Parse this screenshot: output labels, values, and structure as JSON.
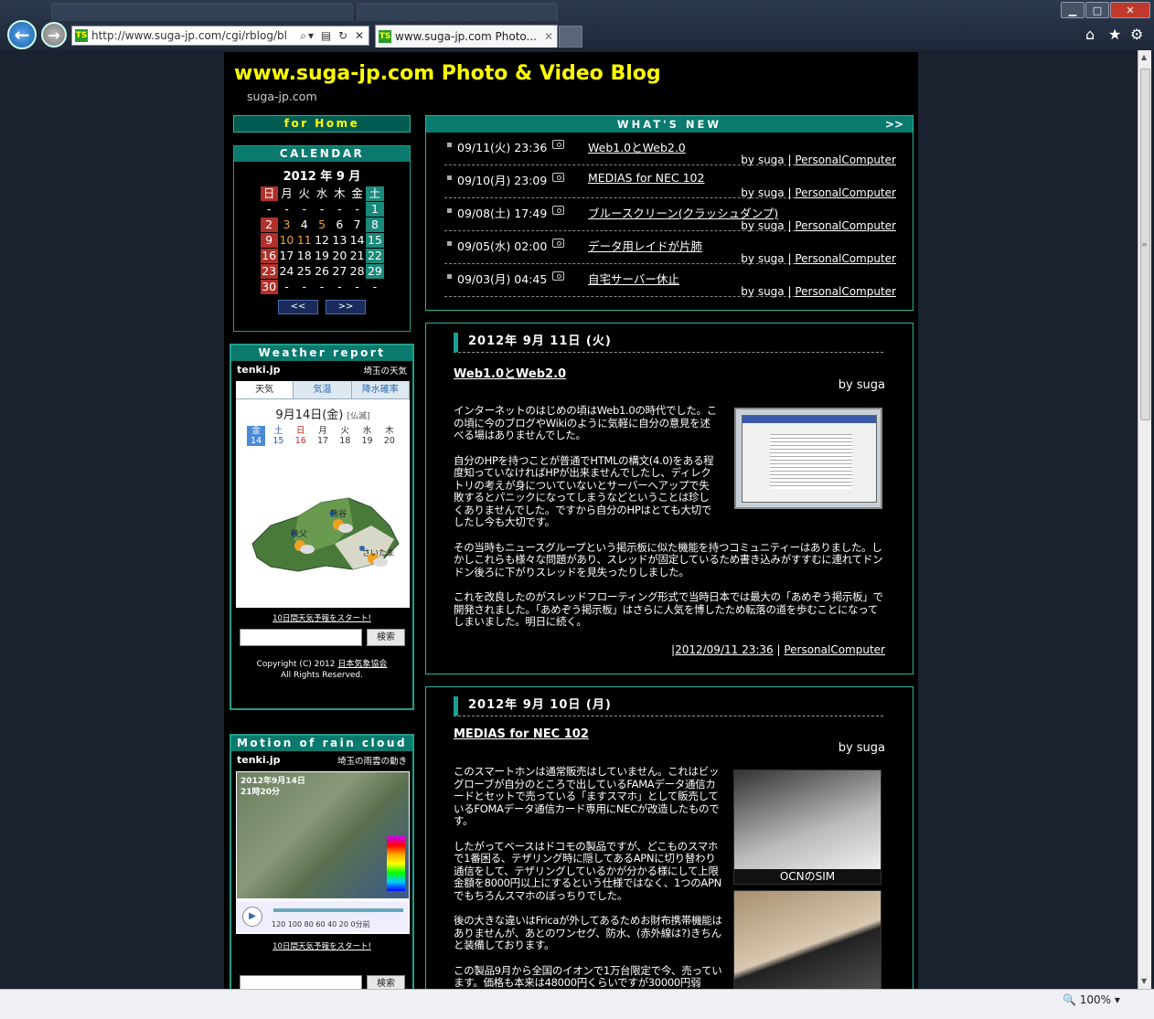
{
  "browser": {
    "address_url": "http://www.suga-jp.com/cgi/rblog/bl",
    "tab_title": "www.suga-jp.com Photo...",
    "favicon_text": "TS",
    "zoom": "100%",
    "icons": [
      "back-icon",
      "forward-icon",
      "search-icon",
      "refresh-icon",
      "close-icon",
      "home-icon",
      "star-icon",
      "gear-icon"
    ]
  },
  "site": {
    "title": "www.suga-jp.com Photo & Video Blog",
    "subtitle": "suga-jp.com"
  },
  "sidebar": {
    "home_link": "for Home",
    "calendar": {
      "header": "CALENDAR",
      "title": "2012 年 9 月",
      "weekdays": [
        "日",
        "月",
        "火",
        "水",
        "木",
        "金",
        "土"
      ],
      "cells": [
        "-",
        "-",
        "-",
        "-",
        "-",
        "-",
        "1",
        "2",
        "3",
        "4",
        "5",
        "6",
        "7",
        "8",
        "9",
        "10",
        "11",
        "12",
        "13",
        "14",
        "15",
        "16",
        "17",
        "18",
        "19",
        "20",
        "21",
        "22",
        "23",
        "24",
        "25",
        "26",
        "27",
        "28",
        "29",
        "30",
        "-",
        "-",
        "-",
        "-",
        "-",
        "-"
      ],
      "prev": "<<",
      "next": ">>"
    },
    "weather": {
      "header": "Weather report",
      "brand": "tenki.jp",
      "region": "埼玉の天気",
      "tabs": [
        "天気",
        "気温",
        "降水確率"
      ],
      "date": "9月14日(金)",
      "rokuyo": "[仏滅]",
      "days": [
        {
          "w": "金",
          "d": "14"
        },
        {
          "w": "土",
          "d": "15"
        },
        {
          "w": "日",
          "d": "16"
        },
        {
          "w": "月",
          "d": "17"
        },
        {
          "w": "火",
          "d": "18"
        },
        {
          "w": "水",
          "d": "19"
        },
        {
          "w": "木",
          "d": "20"
        }
      ],
      "cities": [
        "熊谷",
        "秩父",
        "さいたま"
      ],
      "link": "10日間天気予報をスタート!",
      "search_button": "検索",
      "copyright": "Copyright (C) 2012",
      "copyright_org": "日本気象協会",
      "rights": "All Rights Reserved."
    },
    "rain": {
      "header": "Motion of rain cloud",
      "brand": "tenki.jp",
      "region": "埼玉の雨雲の動き",
      "time_line1": "2012年9月14日",
      "time_line2": "21時20分",
      "ticks": "120 100  80  60  40  20  0分前",
      "link": "10日間天気予報をスタート!",
      "search_button": "検索"
    }
  },
  "whats_new": {
    "header": "WHAT'S NEW",
    "more": ">>",
    "items": [
      {
        "date": "09/11(火) 23:36",
        "title": "Web1.0とWeb2.0",
        "author": "by suga",
        "category": "PersonalComputer"
      },
      {
        "date": "09/10(月) 23:09",
        "title": "MEDIAS for NEC 102",
        "author": "by suga",
        "category": "PersonalComputer"
      },
      {
        "date": "09/08(土) 17:49",
        "title": "ブルースクリーン(クラッシュダンプ)",
        "author": "by suga",
        "category": "PersonalComputer"
      },
      {
        "date": "09/05(水) 02:00",
        "title": "データ用レイドが片肺",
        "author": "by suga",
        "category": "PersonalComputer"
      },
      {
        "date": "09/03(月) 04:45",
        "title": "自宅サーバー休止",
        "author": "by suga",
        "category": "PersonalComputer"
      }
    ]
  },
  "posts": [
    {
      "date": "2012年 9月 11日 (火)",
      "title": "Web1.0とWeb2.0",
      "author": "by suga",
      "paragraphs": [
        "インターネットのはじめの頃はWeb1.0の時代でした。この頃に今のブログやWikiのように気軽に自分の意見を述べる場はありませんでした。",
        "自分のHPを持つことが普通でHTMLの構文(4.0)をある程度知っていなければHPが出来ませんでしたし、ディレクトリの考えが身についていないとサーバーへアップで失敗するとパニックになってしまうなどということは珍しくありませんでした。ですから自分のHPはとても大切でしたし今も大切です。",
        "その当時もニュースグループという掲示板に似た機能を持つコミュニティーはありました。しかしこれらも様々な問題があり、スレッドが固定しているため書き込みがすすむに連れてドンドン後ろに下がりスレッドを見失ったりしました。",
        "これを改良したのがスレッドフローティング形式で当時日本では最大の「あめぞう掲示板」で開発されました。「あめぞう掲示板」はさらに人気を博したため転落の道を歩むことになってしまいました。明日に続く。"
      ],
      "footer_date": "2012/09/11 23:36",
      "footer_category": "PersonalComputer"
    },
    {
      "date": "2012年 9月 10日 (月)",
      "title": "MEDIAS for NEC 102",
      "author": "by suga",
      "paragraphs": [
        "このスマートホンは通常販売はしていません。これはビッグローブが自分のところで出しているFAMAデータ通信カードとセットで売っている「ますスマホ」として販売しているFOMAデータ通信カード専用にNECが改造したものです。",
        "したがってベースはドコモの製品ですが、どこものスマホで1番困る、テザリング時に隠してあるAPNに切り替わり通信をして、テザリングしているかが分かる様にして上限金額を8000円以上にするという仕様ではなく、1つのAPNでもちろんスマホのぼっちりでした。",
        "後の大きな違いはFricaが外してあるためお財布携帯機能はありませんが、あとのワンセグ、防水、(赤外線は?)きちんと装備しております。",
        "この製品9月から全国のイオンで1万台限定で今、売っています。価格も本来は48000円くらいですが30000円弱"
      ],
      "photo_caption": "OCNのSIM"
    }
  ]
}
